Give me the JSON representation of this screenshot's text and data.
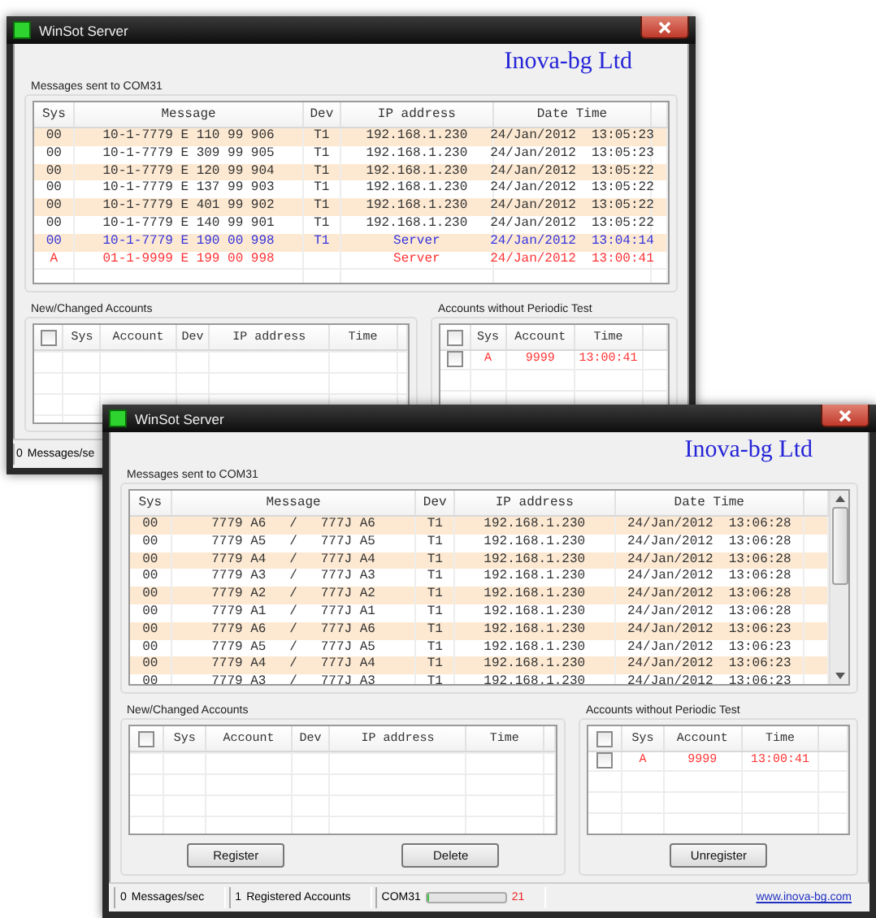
{
  "windows": [
    {
      "title": "WinSot Server",
      "company": "Inova-bg Ltd",
      "scrollbar": false,
      "messages": {
        "label": "Messages sent to COM31",
        "columns": [
          "Sys",
          "Message",
          "Dev",
          "IP address",
          "Date Time"
        ],
        "rows": [
          {
            "sys": "00",
            "message": "10-1-7779 E 110 99 906",
            "dev": "T1",
            "ip": "192.168.1.230",
            "datetime": "24/Jan/2012  13:05:23",
            "color": "#333333"
          },
          {
            "sys": "00",
            "message": "10-1-7779 E 309 99 905",
            "dev": "T1",
            "ip": "192.168.1.230",
            "datetime": "24/Jan/2012  13:05:23",
            "color": "#333333"
          },
          {
            "sys": "00",
            "message": "10-1-7779 E 120 99 904",
            "dev": "T1",
            "ip": "192.168.1.230",
            "datetime": "24/Jan/2012  13:05:22",
            "color": "#333333"
          },
          {
            "sys": "00",
            "message": "10-1-7779 E 137 99 903",
            "dev": "T1",
            "ip": "192.168.1.230",
            "datetime": "24/Jan/2012  13:05:22",
            "color": "#333333"
          },
          {
            "sys": "00",
            "message": "10-1-7779 E 401 99 902",
            "dev": "T1",
            "ip": "192.168.1.230",
            "datetime": "24/Jan/2012  13:05:22",
            "color": "#333333"
          },
          {
            "sys": "00",
            "message": "10-1-7779 E 140 99 901",
            "dev": "T1",
            "ip": "192.168.1.230",
            "datetime": "24/Jan/2012  13:05:22",
            "color": "#333333"
          },
          {
            "sys": "00",
            "message": "10-1-7779 E 190 00 998",
            "dev": "T1",
            "ip": "Server",
            "datetime": "24/Jan/2012  13:04:14",
            "color": "#3333dd"
          },
          {
            "sys": "A",
            "message": "01-1-9999 E 199 00 998",
            "ip": "Server",
            "datetime": "24/Jan/2012  13:00:41",
            "color": "#ff3333"
          }
        ]
      },
      "new_accounts": {
        "label": "New/Changed Accounts",
        "all_checked": false,
        "columns": [
          "Sys",
          "Account",
          "Dev",
          "IP address",
          "Time"
        ]
      },
      "no_test": {
        "label": "Accounts without Periodic Test",
        "all_checked": false,
        "columns": [
          "Sys",
          "Account",
          "Time"
        ],
        "rows": [
          {
            "checked": false,
            "sys": "A",
            "account": "9999",
            "time": "13:00:41",
            "color": "#ff3333"
          }
        ]
      },
      "status_bar": {
        "items": [
          {
            "kind": "count",
            "value": "0",
            "label": "Messages/se"
          }
        ]
      }
    },
    {
      "title": "WinSot Server",
      "company": "Inova-bg Ltd",
      "scrollbar": true,
      "messages": {
        "label": "Messages sent to COM31",
        "columns": [
          "Sys",
          "Message",
          "Dev",
          "IP address",
          "Date Time"
        ],
        "rows": [
          {
            "sys": "00",
            "message": "7779 A6   /   777J A6",
            "dev": "T1",
            "ip": "192.168.1.230",
            "datetime": "24/Jan/2012  13:06:28",
            "color": "#333333"
          },
          {
            "sys": "00",
            "message": "7779 A5   /   777J A5",
            "dev": "T1",
            "ip": "192.168.1.230",
            "datetime": "24/Jan/2012  13:06:28",
            "color": "#333333"
          },
          {
            "sys": "00",
            "message": "7779 A4   /   777J A4",
            "dev": "T1",
            "ip": "192.168.1.230",
            "datetime": "24/Jan/2012  13:06:28",
            "color": "#333333"
          },
          {
            "sys": "00",
            "message": "7779 A3   /   777J A3",
            "dev": "T1",
            "ip": "192.168.1.230",
            "datetime": "24/Jan/2012  13:06:28",
            "color": "#333333"
          },
          {
            "sys": "00",
            "message": "7779 A2   /   777J A2",
            "dev": "T1",
            "ip": "192.168.1.230",
            "datetime": "24/Jan/2012  13:06:28",
            "color": "#333333"
          },
          {
            "sys": "00",
            "message": "7779 A1   /   777J A1",
            "dev": "T1",
            "ip": "192.168.1.230",
            "datetime": "24/Jan/2012  13:06:28",
            "color": "#333333"
          },
          {
            "sys": "00",
            "message": "7779 A6   /   777J A6",
            "dev": "T1",
            "ip": "192.168.1.230",
            "datetime": "24/Jan/2012  13:06:23",
            "color": "#333333"
          },
          {
            "sys": "00",
            "message": "7779 A5   /   777J A5",
            "dev": "T1",
            "ip": "192.168.1.230",
            "datetime": "24/Jan/2012  13:06:23",
            "color": "#333333"
          },
          {
            "sys": "00",
            "message": "7779 A4   /   777J A4",
            "dev": "T1",
            "ip": "192.168.1.230",
            "datetime": "24/Jan/2012  13:06:23",
            "color": "#333333"
          },
          {
            "sys": "00",
            "message": "7779 A3   /   777J A3",
            "dev": "T1",
            "ip": "192.168.1.230",
            "datetime": "24/Jan/2012  13:06:23",
            "color": "#333333"
          }
        ]
      },
      "new_accounts": {
        "label": "New/Changed Accounts",
        "all_checked": false,
        "columns": [
          "Sys",
          "Account",
          "Dev",
          "IP address",
          "Time"
        ],
        "buttons": [
          "Register",
          "Delete"
        ]
      },
      "no_test": {
        "label": "Accounts without Periodic Test",
        "all_checked": false,
        "columns": [
          "Sys",
          "Account",
          "Time"
        ],
        "rows": [
          {
            "checked": false,
            "sys": "A",
            "account": "9999",
            "time": "13:00:41",
            "color": "#ff3333"
          }
        ],
        "buttons": [
          "Unregister"
        ]
      },
      "status_bar": {
        "items": [
          {
            "kind": "count",
            "value": "0",
            "label": "Messages/sec"
          },
          {
            "kind": "count",
            "value": "1",
            "label": "Registered Accounts"
          },
          {
            "kind": "port",
            "label": "COM31",
            "level": 0.02,
            "value": "21"
          }
        ],
        "link": "www.inova-bg.com"
      }
    }
  ]
}
